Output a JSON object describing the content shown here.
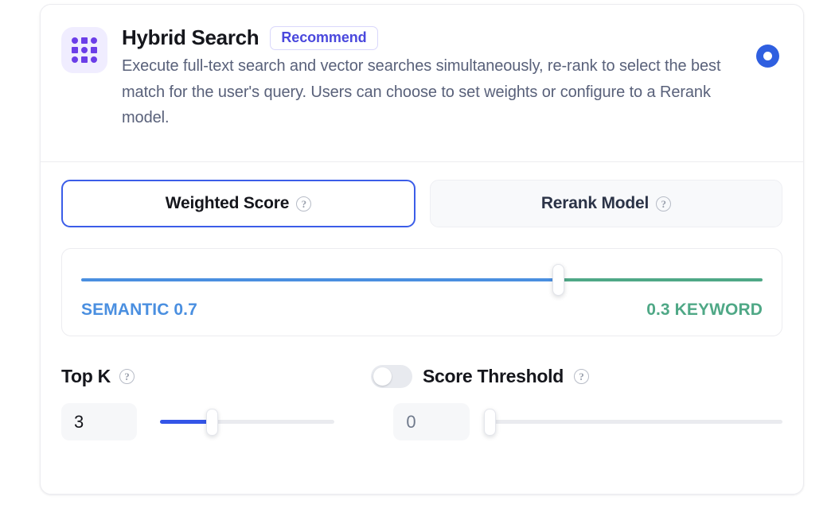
{
  "card": {
    "icon_name": "grid-dots-icon",
    "title": "Hybrid Search",
    "badge": "Recommend",
    "description": "Execute full-text search and vector searches simultaneously, re-rank to select the best match for the user's query. Users can choose to set weights or configure to a Rerank model.",
    "selected": true,
    "radio_icon": "radio-selected-icon"
  },
  "tabs": [
    {
      "label": "Weighted Score",
      "active": true,
      "help_icon": "help-circle-icon"
    },
    {
      "label": "Rerank Model",
      "active": false,
      "help_icon": "help-circle-icon"
    }
  ],
  "weight_slider": {
    "semantic_label": "SEMANTIC 0.7",
    "keyword_label": "0.3 KEYWORD",
    "semantic_value": 0.7,
    "keyword_value": 0.3,
    "semantic_percent": "70%",
    "thumb_position": "70%",
    "semantic_color": "#4a8fe0",
    "keyword_color": "#4fa886"
  },
  "top_k": {
    "label": "Top K",
    "help_icon": "help-circle-icon",
    "value": "3",
    "fill_percent": "30%",
    "thumb_position": "30%"
  },
  "score_threshold": {
    "label": "Score Threshold",
    "help_icon": "help-circle-icon",
    "toggle_icon": "toggle-off-icon",
    "enabled": false,
    "value": "0",
    "fill_percent": "0%",
    "thumb_position": "0%"
  },
  "glyphs": {
    "help": "?"
  },
  "colors": {
    "accent_blue": "#3355e8",
    "tab_border": "#3b5de8",
    "badge_text": "#4a48dd",
    "icon_purple": "#6b3ee8",
    "radio_blue": "#2f5fe0"
  }
}
